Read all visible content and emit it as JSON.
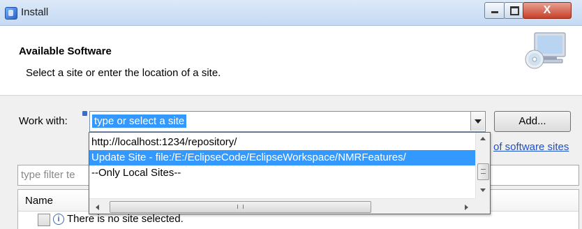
{
  "window": {
    "title": "Install",
    "minimize_icon": "minimize-icon",
    "maximize_icon": "maximize-icon",
    "close_icon": "close-icon",
    "close_glyph": "X"
  },
  "header": {
    "title": "Available Software",
    "description": "Select a site or enter the location of a site."
  },
  "work_with": {
    "label": "Work with:",
    "value": "type or select a site",
    "add_label": "Add...",
    "dropdown_items": [
      "http://localhost:1234/repository/",
      "Update Site - file:/E:/EclipseCode/EclipseWorkspace/NMRFeatures/",
      "--Only Local Sites--"
    ],
    "selected_index": 1
  },
  "link": {
    "text": "of software sites"
  },
  "filter": {
    "placeholder": "type filter te"
  },
  "table": {
    "column_header": "Name",
    "rows": [
      {
        "text": "There is no site selected.",
        "icon": "info-icon"
      }
    ]
  },
  "colors": {
    "accent": "#3399ff",
    "link": "#1d50c4",
    "close_button": "#c8402a"
  }
}
